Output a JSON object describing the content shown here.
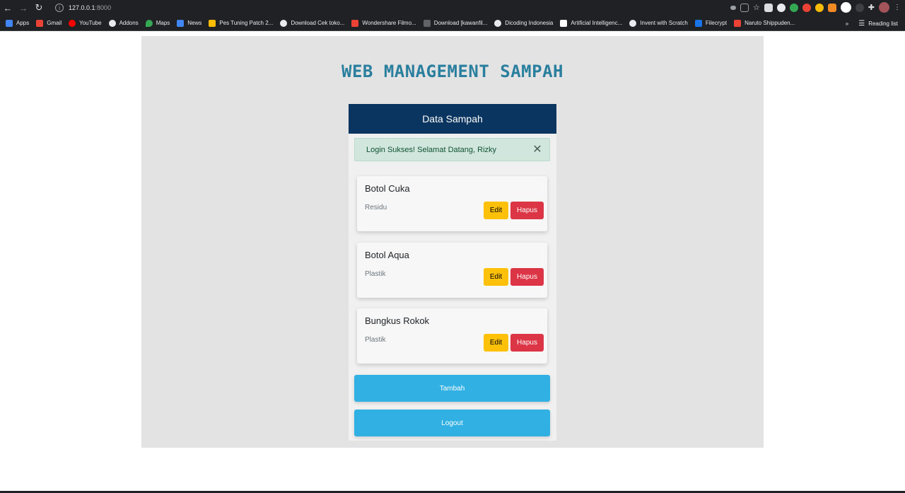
{
  "browser": {
    "url_host": "127.0.0.1",
    "url_port": ":8000",
    "bookmarks": [
      {
        "label": "Apps",
        "color": "#4285f4"
      },
      {
        "label": "Gmail",
        "color": "#ea4335"
      },
      {
        "label": "YouTube",
        "color": "#ff0000"
      },
      {
        "label": "Addons",
        "color": "#e8eaed"
      },
      {
        "label": "Maps",
        "color": "#34a853"
      },
      {
        "label": "News",
        "color": "#4285f4"
      },
      {
        "label": "Pes Tuning Patch 2...",
        "color": "#fbbc04"
      },
      {
        "label": "Download Cek toko...",
        "color": "#e8eaed"
      },
      {
        "label": "Wondershare Filmo...",
        "color": "#ea4335"
      },
      {
        "label": "Download [kawanfil...",
        "color": "#5f6368"
      },
      {
        "label": "Dicoding Indonesia",
        "color": "#e8eaed"
      },
      {
        "label": "Artificial Intelligenc...",
        "color": "#ffffff"
      },
      {
        "label": "Invent with Scratch",
        "color": "#e8eaed"
      },
      {
        "label": "Filecrypt",
        "color": "#1a73e8"
      },
      {
        "label": "Naruto Shippuden...",
        "color": "#ea4335"
      }
    ],
    "more_label": "»",
    "reading_list": "Reading list"
  },
  "app": {
    "title": "WEB MANAGEMENT SAMPAH",
    "card_header": "Data Sampah",
    "alert": "Login Sukses! Selamat Datang, Rizky",
    "alert_close": "✕",
    "items": [
      {
        "name": "Botol Cuka",
        "type": "Residu",
        "edit": "Edit",
        "delete": "Hapus"
      },
      {
        "name": "Botol Aqua",
        "type": "Plastik",
        "edit": "Edit",
        "delete": "Hapus"
      },
      {
        "name": "Bungkus Rokok",
        "type": "Plastik",
        "edit": "Edit",
        "delete": "Hapus"
      }
    ],
    "add_button": "Tambah",
    "logout_button": "Logout"
  },
  "colors": {
    "header": "#0b3561",
    "title": "#2a7f9e",
    "accent": "#31b0e3",
    "edit": "#ffc107",
    "delete": "#dc3545",
    "alert_bg": "#d1e7dd"
  }
}
